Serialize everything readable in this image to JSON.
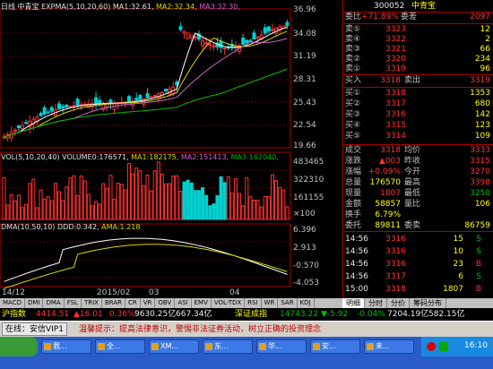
{
  "chart_header": {
    "period": "日线",
    "stock_name": "中青宝",
    "expma": "EXPMA(5,10,20,60)",
    "ma1": "MA1:32.61,",
    "ma2": "MA2:32.34,",
    "ma3": "MA3:32.30,"
  },
  "price_axis": [
    "36.96",
    "34.08",
    "31.19",
    "28.31",
    "25.43",
    "22.54",
    "19.66"
  ],
  "volume_header": {
    "label": "VOL(5,10,20,40)",
    "volume": "VOLUME0:176571,",
    "ma1": "MA1:182175,",
    "ma2": "MA2:151413,",
    "ma3": "MA3:162040,"
  },
  "volume_axis": [
    "483465",
    "322310",
    "161155",
    "×100"
  ],
  "dma_header": {
    "label": "DMA(10,50,10)",
    "ddd": "DDD:0.342,",
    "ama": "AMA:1.218"
  },
  "dma_axis": [
    "6.396",
    "2.913",
    "-0.570",
    "-4.053"
  ],
  "date_axis": [
    "14/12",
    "2015/02",
    "03",
    "04"
  ],
  "indicator_tabs": [
    "MACD",
    "DMI",
    "DMA",
    "FSL",
    "TRIX",
    "BRAR",
    "CR",
    "VR",
    "OBV",
    "ASI",
    "EMV",
    "VOL-TDX",
    "RSI",
    "WR",
    "SAR",
    "KDJ"
  ],
  "chart_data": {
    "type": "candlestick",
    "title": "日线 中青宝",
    "price_ylim": [
      19.66,
      36.96
    ],
    "volume_ylim": [
      0,
      483465
    ],
    "dma_ylim": [
      -4.053,
      6.396
    ]
  },
  "quote": {
    "code": "300052",
    "name": "中青宝",
    "weibi_label": "委比",
    "weibi": "+71.89%",
    "weicha_label": "委差",
    "weicha": "2097",
    "asks": [
      {
        "label": "卖⑤",
        "price": "3323",
        "vol": "12"
      },
      {
        "label": "卖④",
        "price": "3322",
        "vol": "2"
      },
      {
        "label": "卖③",
        "price": "3321",
        "vol": "66"
      },
      {
        "label": "卖②",
        "price": "3320",
        "vol": "234"
      },
      {
        "label": "卖①",
        "price": "3319",
        "vol": "96"
      }
    ],
    "buy_in_label": "买入",
    "buy_in": "3318",
    "sell_out_label": "卖出",
    "sell_out": "3319",
    "bids": [
      {
        "label": "买①",
        "price": "3318",
        "vol": "1353"
      },
      {
        "label": "买②",
        "price": "3317",
        "vol": "680"
      },
      {
        "label": "买③",
        "price": "3316",
        "vol": "142"
      },
      {
        "label": "买④",
        "price": "3315",
        "vol": "123"
      },
      {
        "label": "买⑤",
        "price": "3314",
        "vol": "109"
      }
    ],
    "stats": [
      {
        "l1": "成交",
        "v1": "3318",
        "l2": "均价",
        "v2": "3333"
      },
      {
        "l1": "涨跌",
        "v1": "▲003",
        "l2": "昨收",
        "v2": "3315"
      },
      {
        "l1": "涨幅",
        "v1": "+0.09%",
        "l2": "今开",
        "v2": "3270"
      },
      {
        "l1": "总量",
        "v1": "176570",
        "l2": "最高",
        "v2": "3398"
      },
      {
        "l1": "现量",
        "v1": "1807",
        "l2": "最低",
        "v2": "3250"
      },
      {
        "l1": "金额",
        "v1": "58857",
        "l2": "量比",
        "v2": "106"
      },
      {
        "l1": "换手",
        "v1": "6.79%",
        "l2": "",
        "v2": ""
      },
      {
        "l1": "委托",
        "v1": "89811",
        "l2": "委卖",
        "v2": "86759"
      }
    ],
    "ticks": [
      {
        "time": "14:56",
        "price": "3316",
        "vol": "15",
        "dir": "S"
      },
      {
        "time": "14:56",
        "price": "3316",
        "vol": "10",
        "dir": "S"
      },
      {
        "time": "14:56",
        "price": "3316",
        "vol": "23",
        "dir": "B"
      },
      {
        "time": "14:56",
        "price": "3317",
        "vol": "6",
        "dir": "S"
      },
      {
        "time": "15:00",
        "price": "3318",
        "vol": "1807",
        "dir": "B"
      }
    ]
  },
  "panel_tabs": [
    "明细",
    "分时",
    "分价",
    "筹码分布"
  ],
  "index_bar": {
    "sh_label": "沪指数",
    "sh_value": "4414.51",
    "sh_change": "▲16.01",
    "sh_pct": "0.36%",
    "sh_vol": "9630.25亿",
    "sh_amt": "667.34亿",
    "sz_label": "深证成指",
    "sz_value": "14743.22",
    "sz_change": "▼-5.92",
    "sz_pct": "-0.04%",
    "sz_vol": "7204.19亿",
    "sz_amt": "582.15亿"
  },
  "ticker": {
    "prefix": "在线：安信VIP1",
    "message": "温馨提示：提高法律意识，警惕非法证券活动，树立正确的投资理念"
  },
  "taskbar": {
    "buttons": [
      "我...",
      "全...",
      "XM...",
      "东...",
      "华...",
      "安...",
      "未..."
    ],
    "clock": "16:10"
  }
}
